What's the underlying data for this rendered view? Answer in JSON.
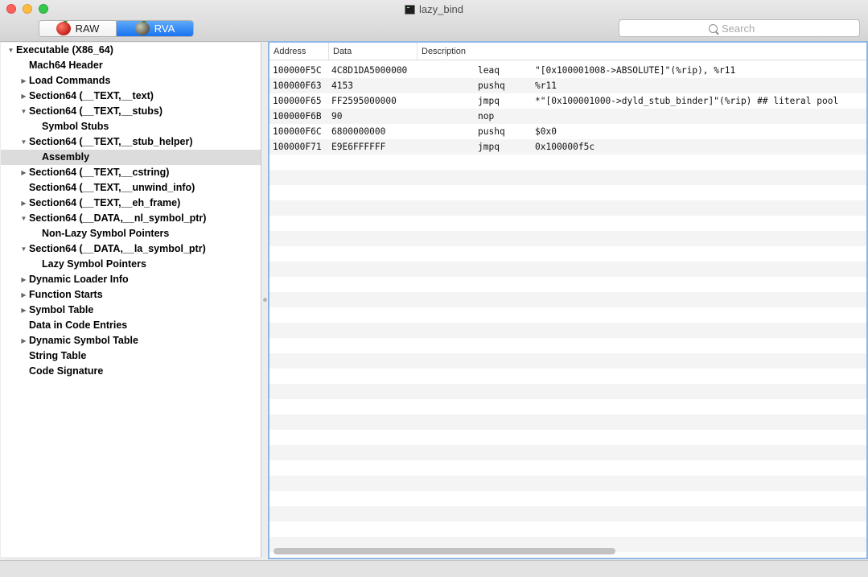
{
  "window": {
    "title": "lazy_bind"
  },
  "toolbar": {
    "mode_raw": "RAW",
    "mode_rva": "RVA",
    "selected_mode": "RVA",
    "search_placeholder": "Search"
  },
  "colors": {
    "accent": "#1973f0",
    "selection": "#dcdcdc",
    "focus_border": "#8fb7e6"
  },
  "outline": [
    {
      "label": "Executable  (X86_64)",
      "depth": 0,
      "state": "expanded"
    },
    {
      "label": "Mach64 Header",
      "depth": 1,
      "state": "leaf"
    },
    {
      "label": "Load Commands",
      "depth": 1,
      "state": "collapsed"
    },
    {
      "label": "Section64 (__TEXT,__text)",
      "depth": 1,
      "state": "collapsed"
    },
    {
      "label": "Section64 (__TEXT,__stubs)",
      "depth": 1,
      "state": "expanded"
    },
    {
      "label": "Symbol Stubs",
      "depth": 2,
      "state": "leaf"
    },
    {
      "label": "Section64 (__TEXT,__stub_helper)",
      "depth": 1,
      "state": "expanded"
    },
    {
      "label": "Assembly",
      "depth": 2,
      "state": "leaf",
      "selected": true
    },
    {
      "label": "Section64 (__TEXT,__cstring)",
      "depth": 1,
      "state": "collapsed"
    },
    {
      "label": "Section64 (__TEXT,__unwind_info)",
      "depth": 1,
      "state": "leaf"
    },
    {
      "label": "Section64 (__TEXT,__eh_frame)",
      "depth": 1,
      "state": "collapsed"
    },
    {
      "label": "Section64 (__DATA,__nl_symbol_ptr)",
      "depth": 1,
      "state": "expanded"
    },
    {
      "label": "Non-Lazy Symbol Pointers",
      "depth": 2,
      "state": "leaf"
    },
    {
      "label": "Section64 (__DATA,__la_symbol_ptr)",
      "depth": 1,
      "state": "expanded"
    },
    {
      "label": "Lazy Symbol Pointers",
      "depth": 2,
      "state": "leaf"
    },
    {
      "label": "Dynamic Loader Info",
      "depth": 1,
      "state": "collapsed"
    },
    {
      "label": "Function Starts",
      "depth": 1,
      "state": "collapsed"
    },
    {
      "label": "Symbol Table",
      "depth": 1,
      "state": "collapsed"
    },
    {
      "label": "Data in Code Entries",
      "depth": 1,
      "state": "leaf"
    },
    {
      "label": "Dynamic Symbol Table",
      "depth": 1,
      "state": "collapsed"
    },
    {
      "label": "String Table",
      "depth": 1,
      "state": "leaf"
    },
    {
      "label": "Code Signature",
      "depth": 1,
      "state": "leaf"
    }
  ],
  "table": {
    "columns": [
      "Address",
      "Data",
      "Description"
    ],
    "rows": [
      {
        "address": "100000F5C",
        "data": "4C8D1DA5000000",
        "mnemonic": "leaq",
        "operands": "\"[0x100001008->ABSOLUTE]\"(%rip), %r11"
      },
      {
        "address": "100000F63",
        "data": "4153",
        "mnemonic": "pushq",
        "operands": "%r11"
      },
      {
        "address": "100000F65",
        "data": "FF2595000000",
        "mnemonic": "jmpq",
        "operands": "*\"[0x100001000->dyld_stub_binder]\"(%rip) ## literal pool"
      },
      {
        "address": "100000F6B",
        "data": "90",
        "mnemonic": "nop",
        "operands": ""
      },
      {
        "address": "100000F6C",
        "data": "6800000000",
        "mnemonic": "pushq",
        "operands": "$0x0"
      },
      {
        "address": "100000F71",
        "data": "E9E6FFFFFF",
        "mnemonic": "jmpq",
        "operands": "0x100000f5c"
      }
    ]
  }
}
